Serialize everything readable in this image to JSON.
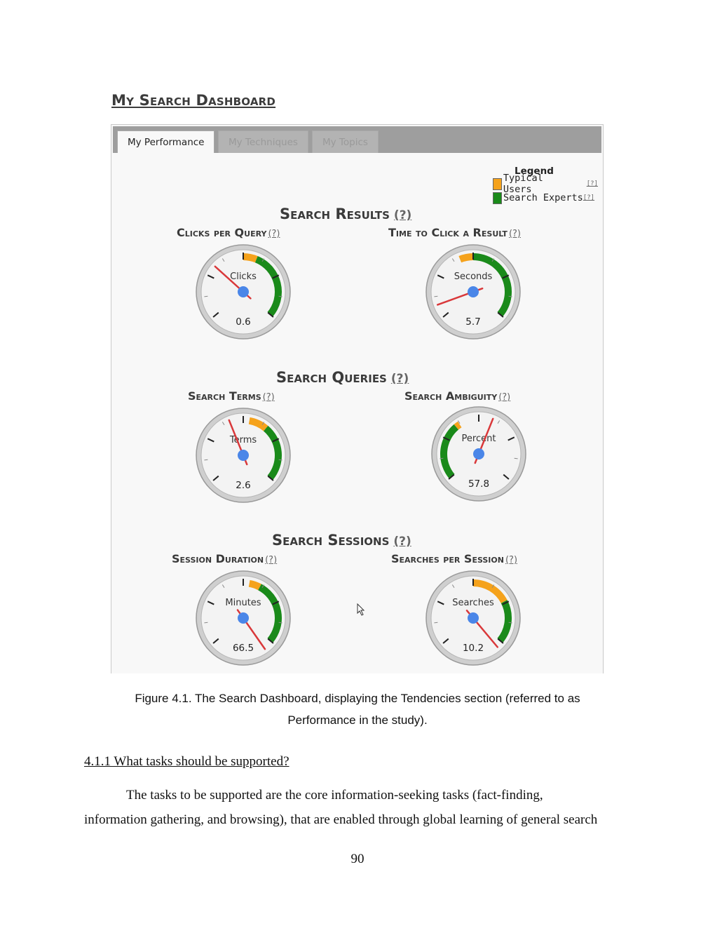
{
  "dashboard_title": "My Search Dashboard",
  "tabs": [
    {
      "label": "My Performance",
      "active": true
    },
    {
      "label": "My Techniques",
      "active": false
    },
    {
      "label": "My Topics",
      "active": false
    }
  ],
  "legend": {
    "title": "Legend",
    "help": "[?]",
    "items": [
      {
        "label": "Typical Users",
        "color": "#f5a21b"
      },
      {
        "label": "Search Experts",
        "color": "#1a8a1a"
      }
    ]
  },
  "help_link": "(?)",
  "sections": [
    {
      "title": "Search Results",
      "gauges": [
        {
          "title": "Clicks per Query",
          "unit": "Clicks",
          "value": "0.6",
          "needle_deg": -48,
          "orange": [
            0,
            22
          ],
          "green": [
            22,
            130
          ]
        },
        {
          "title": "Time to Click a Result",
          "unit": "Seconds",
          "value": "5.7",
          "needle_deg": -110,
          "orange": [
            -22,
            0
          ],
          "green": [
            0,
            130
          ]
        }
      ]
    },
    {
      "title": "Search Queries",
      "gauges": [
        {
          "title": "Search Terms",
          "unit": "Terms",
          "value": "2.6",
          "needle_deg": -22,
          "orange": [
            10,
            40
          ],
          "green": [
            40,
            130
          ]
        },
        {
          "title": "Search Ambiguity",
          "unit": "Percent",
          "value": "57.8",
          "needle_deg": 22,
          "orange": [
            -40,
            -33
          ],
          "green": [
            -130,
            -40
          ]
        }
      ]
    },
    {
      "title": "Search Sessions",
      "gauges": [
        {
          "title": "Session Duration",
          "unit": "Minutes",
          "value": "66.5",
          "needle_deg": 145,
          "orange": [
            10,
            28
          ],
          "green": [
            28,
            130
          ]
        },
        {
          "title": "Searches per Session",
          "unit": "Searches",
          "value": "10.2",
          "needle_deg": 140,
          "orange": [
            0,
            62
          ],
          "green": [
            62,
            130
          ]
        }
      ]
    }
  ],
  "caption_line1": "Figure 4.1. The Search Dashboard, displaying the Tendencies section (referred to as",
  "caption_line2": "Performance in the study).",
  "subheading": "4.1.1 What tasks should be supported?",
  "body_line1": "The tasks to be supported are the core information-seeking tasks (fact-finding,",
  "body_line2": "information gathering, and browsing), that are enabled through global learning of general search",
  "page_number": "90"
}
